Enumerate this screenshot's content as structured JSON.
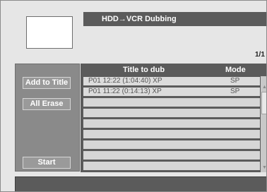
{
  "header": {
    "title": "HDD→VCR Dubbing",
    "page_indicator": "1/1"
  },
  "left_panel": {
    "add_to_title_label": "Add to Title",
    "all_erase_label": "All Erase",
    "start_label": "Start"
  },
  "list": {
    "columns": [
      "Title to dub",
      "Mode"
    ],
    "rows": [
      {
        "title": "P01  12:22 (1:04:40) XP",
        "mode": "SP"
      },
      {
        "title": "P01  11:22 (0:14:13) XP",
        "mode": "SP"
      }
    ],
    "empty_rows": 8
  },
  "colors": {
    "header_bg": "#5b5b5b",
    "panel_bg": "#8a8a8a",
    "row_bg": "#d6d6d6"
  }
}
